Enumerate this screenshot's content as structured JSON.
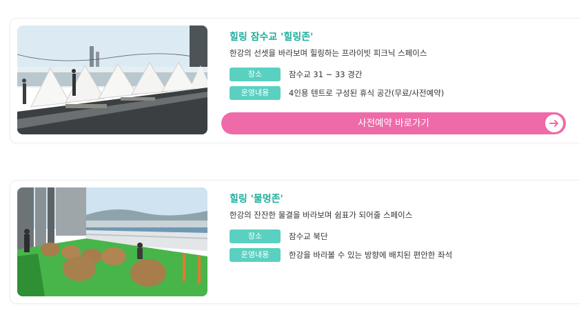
{
  "cards": [
    {
      "image": "tent-pavilions-riverside-photo",
      "title": "힐링 잠수교 '힐링존'",
      "description": "한강의 선셋을 바라보며 힐링하는 프라이빗 피크닉 스페이스",
      "rows": [
        {
          "tag": "장소",
          "value": "잠수교 31 ~ 33 경간"
        },
        {
          "tag": "운영내용",
          "value": "4인용 텐트로 구성된 휴식 공간(무료/사전예약)"
        }
      ],
      "cta": {
        "label": "사전예약 바로가기",
        "icon": "arrow-right-icon"
      }
    },
    {
      "image": "wooden-seats-on-green-turf-photo",
      "title": "힐링 '물멍존'",
      "description": "한강의 잔잔한 물결을 바라보며 쉼표가 되어줄 스페이스",
      "rows": [
        {
          "tag": "장소",
          "value": "잠수교 북단"
        },
        {
          "tag": "운영내용",
          "value": "한강을 바라볼 수 있는 방향에 배치된 편안한 좌석"
        }
      ]
    }
  ],
  "colors": {
    "title": "#1fae9c",
    "tag": "#5ad0c0",
    "cta": "#ef6aa8",
    "card_border": "#eeeeee"
  }
}
